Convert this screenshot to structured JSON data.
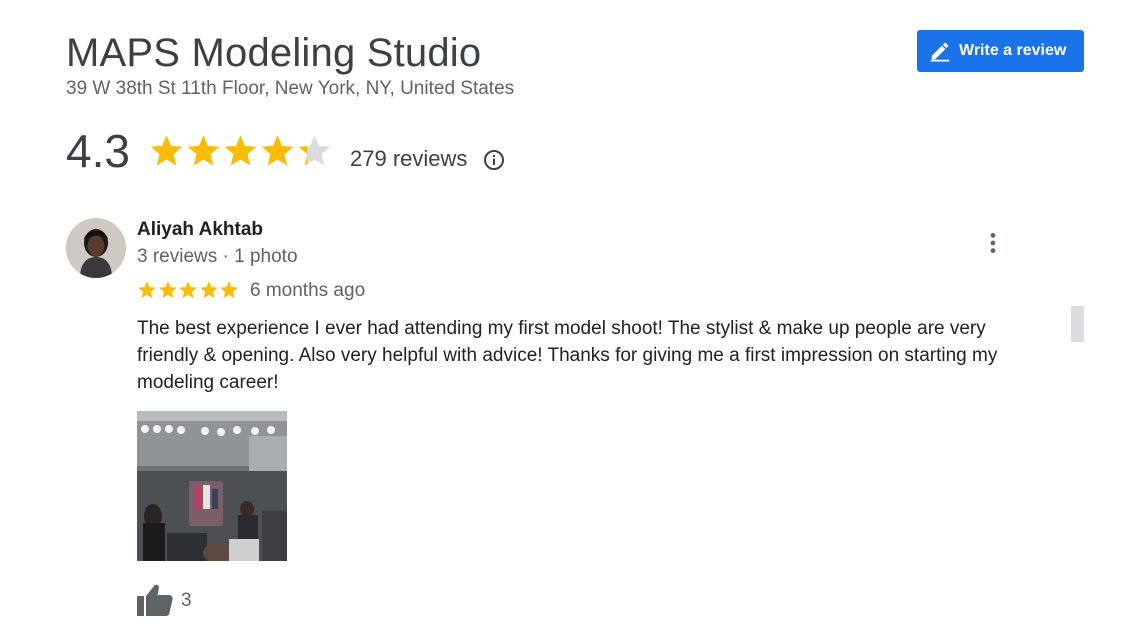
{
  "place": {
    "name": "MAPS Modeling Studio",
    "address": "39 W 38th St 11th Floor, New York, NY, United States"
  },
  "write_review": {
    "label": "Write a review",
    "icon": "pencil-icon"
  },
  "summary": {
    "rating": "4.3",
    "rating_value": 4.3,
    "reviews_label": "279 reviews",
    "info_icon": "info-icon"
  },
  "review": {
    "author": "Aliyah Akhtab",
    "meta": "3 reviews · 1 photo",
    "stars": 5,
    "age": "6 months ago",
    "text": "The best experience I ever had attending my first model shoot! The stylist & make up people are very friendly & opening. Also very helpful with advice! Thanks for giving me a first impression on starting my modeling career!",
    "likes": "3"
  },
  "colors": {
    "accent": "#1a73e8",
    "star": "#fbbc04",
    "star_empty": "#dadce0"
  }
}
